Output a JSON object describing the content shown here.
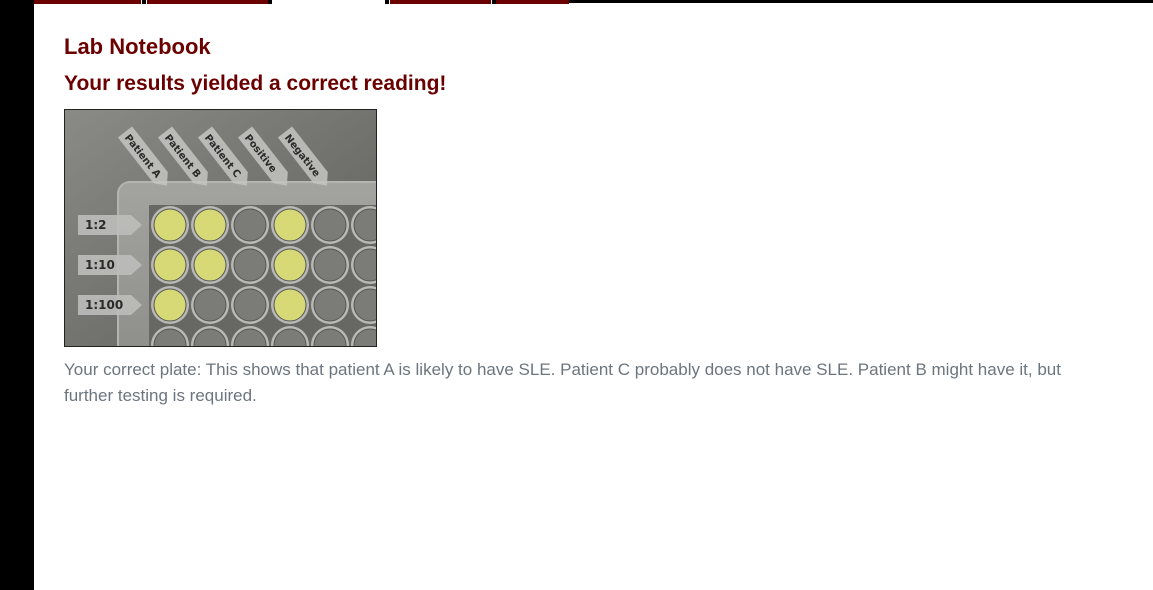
{
  "nav": {
    "tabs": [
      {
        "active": false
      },
      {
        "active": false
      },
      {
        "active": true
      },
      {
        "active": false
      },
      {
        "active": false
      }
    ]
  },
  "notebook": {
    "heading": "Lab Notebook",
    "result": "Your results yielded a correct reading!",
    "caption": "Your correct plate: This shows that patient A is likely to have SLE. Patient C probably does not have SLE. Patient B might have it, but further testing is required."
  },
  "plate": {
    "column_labels": [
      "Patient A",
      "Patient B",
      "Patient C",
      "Positive",
      "Negative"
    ],
    "row_labels": [
      "1:2",
      "1:10",
      "1:100"
    ],
    "wells": [
      [
        true,
        true,
        false,
        true,
        false,
        false
      ],
      [
        true,
        true,
        false,
        true,
        false,
        false
      ],
      [
        true,
        false,
        false,
        true,
        false,
        false
      ]
    ],
    "colors": {
      "positive_well": "#d6d975",
      "empty_well": "#7b7b78",
      "accent": "#6b0000"
    }
  }
}
